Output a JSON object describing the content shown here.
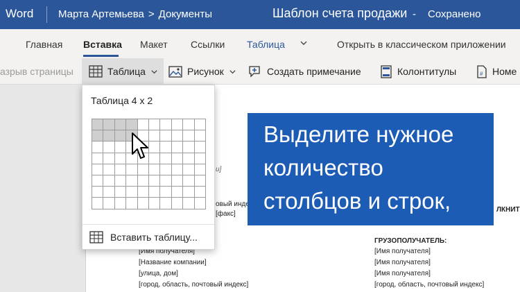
{
  "titlebar": {
    "app_name": "Word",
    "user": "Марта Артемьева",
    "crumb_separator": ">",
    "folder": "Документы",
    "document_title": "Шаблон счета продажи",
    "dash": "-",
    "save_status": "Сохранено"
  },
  "tabs": {
    "items": [
      "Главная",
      "Вставка",
      "Макет",
      "Ссылки",
      "Таблица"
    ],
    "active": "Вставка",
    "open_desktop": "Открыть в классическом приложении"
  },
  "ribbon": {
    "page_break": "азрыв страницы",
    "table": "Таблица",
    "picture": "Рисунок",
    "comment": "Создать примечание",
    "headers": "Колонтитулы",
    "page_numbers": "Номе"
  },
  "dropdown": {
    "header": "Таблица 4 x 2",
    "grid_cols": 10,
    "grid_rows": 8,
    "selected_cols": 4,
    "selected_rows": 2,
    "insert_table": "Вставить таблицу..."
  },
  "document": {
    "italic_fragment": "u]",
    "left_lines": [
      "овый индекс",
      "[факс]"
    ],
    "recipient_lines": [
      "[Имя получателя]",
      "[Название компании]",
      "[улица, дом]",
      "[город, область, почтовый индекс]"
    ],
    "right_heading_cut": "ЛКНИТЕ",
    "consignee_heading": "ГРУЗОПОЛУЧАТЕЛЬ:",
    "consignee_lines": [
      "[Имя получателя]",
      "[Имя получателя]",
      "[Имя получателя]",
      "[город, область, почтовый индекс]"
    ]
  },
  "overlay": {
    "lines": [
      "Выделите нужное",
      "количество",
      "столбцов и строк,"
    ]
  },
  "colors": {
    "brand_blue": "#2b579a",
    "overlay_blue": "#1c5cb5",
    "grid_selected": "#cfcfcf"
  },
  "icons": [
    "chevron-right-icon",
    "chevron-down-icon",
    "table-icon",
    "picture-icon",
    "comment-icon",
    "header-footer-icon",
    "page-number-icon",
    "cursor-arrow-icon"
  ]
}
